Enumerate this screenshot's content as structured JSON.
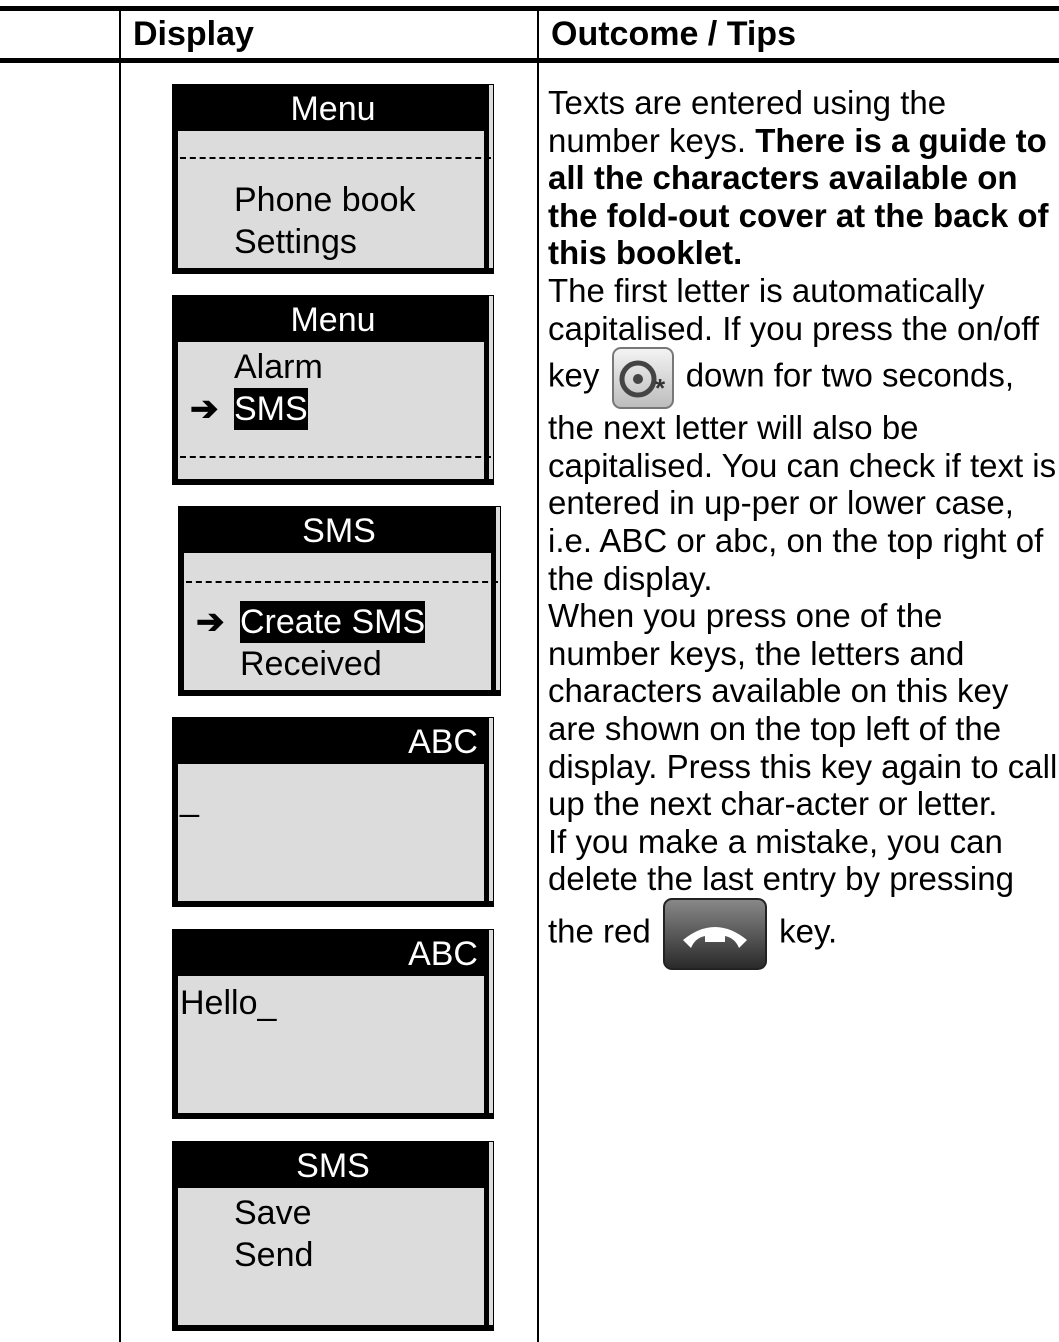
{
  "header": {
    "col1": "Display",
    "col2": "Outcome / Tips"
  },
  "screens": {
    "s1": {
      "title": "Menu",
      "dash": "------------------------",
      "line1": "Phone book",
      "line2": "Settings"
    },
    "s2": {
      "title": "Menu",
      "line1": "Alarm",
      "arrow": "➔",
      "line2": "SMS",
      "dash": "------------------------"
    },
    "s3": {
      "title": "SMS",
      "dash": "------------------------",
      "arrow": "➔",
      "line1": "Create SMS",
      "line2": "Received"
    },
    "s4": {
      "indicator": "ABC",
      "cursor": "_"
    },
    "s5": {
      "indicator": "ABC",
      "text": "Hello_"
    },
    "s6": {
      "title": "SMS",
      "line1": "Save",
      "line2": "Send"
    }
  },
  "tips": {
    "t1": "Texts are entered using the number keys. ",
    "t1_bold": "There is a guide to all the characters available on the fold-out cover at the back of this booklet.",
    "t2": "The first letter is automatically capitalised. If you press the on/off key",
    "t2b": "down for two seconds, the next letter will also be capitalised. You can check if text is entered in up-per or lower case, i.e. ABC or abc, on the top right of the display.",
    "t3": "When you press one of the number keys, the letters and characters available on this key are shown on the top left of the display. Press this key again to call up the next char-acter or letter.",
    "t4": "If you make a mistake, you can delete the last entry by pressing the red",
    "t4b": "key.",
    "onoff_key_symbol": "*"
  },
  "icons": [
    "on-off-key-icon",
    "red-end-key-icon"
  ]
}
